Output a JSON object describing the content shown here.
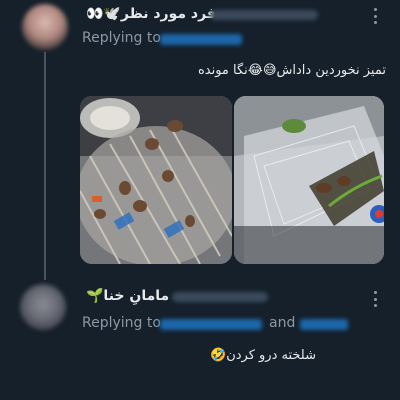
{
  "tweets": [
    {
      "display_name": "فرد مورد نظر🕊️👀",
      "replying_prefix": "Replying to",
      "text": "تمیز نخوردین داداش😅😂نگا مونده",
      "media": [
        {
          "icon": "photo-kebab-skewers"
        },
        {
          "icon": "photo-plastic-container"
        }
      ]
    },
    {
      "display_name": "مامانِ خنا🌱",
      "replying_prefix": "Replying to",
      "replying_and": "and",
      "text": "شلخته درو کردن🤣"
    }
  ],
  "colors": {
    "background": "#15202b",
    "text": "#e7e9ea",
    "secondary": "#8b98a5",
    "link": "#1d9bf0",
    "thread_line": "#4a5561"
  }
}
